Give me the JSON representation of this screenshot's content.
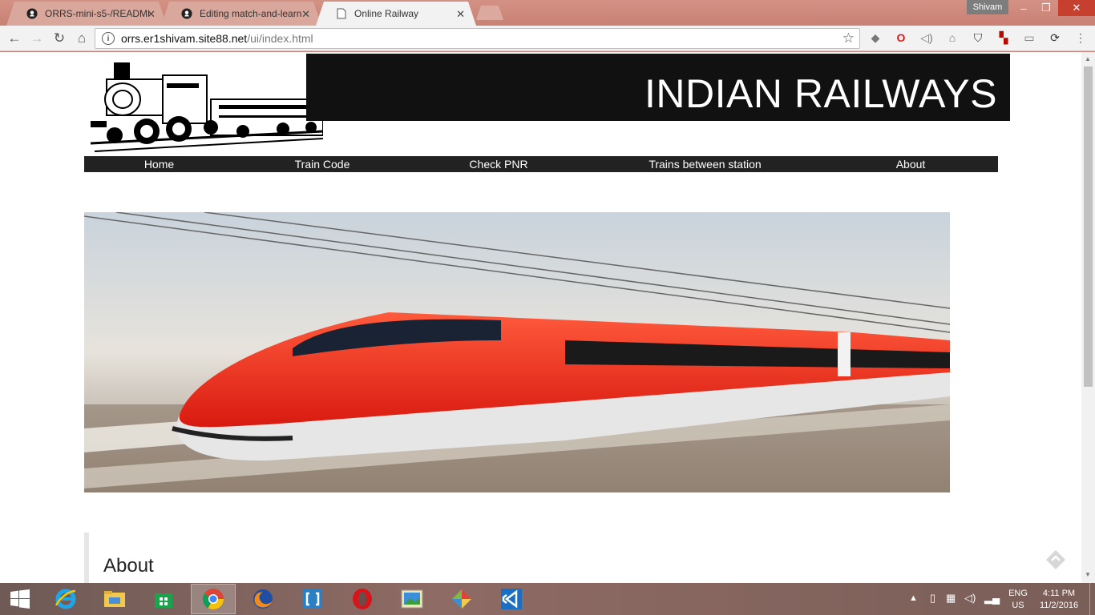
{
  "browser": {
    "tabs": [
      {
        "title": "ORRS-mini-s5-/README",
        "icon": "github-icon",
        "active": false
      },
      {
        "title": "Editing match-and-learn",
        "icon": "github-icon",
        "active": false
      },
      {
        "title": "Online Railway",
        "icon": "page-icon",
        "active": true
      }
    ],
    "profile_name": "Shivam",
    "url_host": "orrs.er1shivam.site88.net",
    "url_path": "/ui/index.html"
  },
  "page": {
    "brand_title": "INDIAN RAILWAYS",
    "menu": [
      {
        "label": "Home"
      },
      {
        "label": "Train Code"
      },
      {
        "label": "Check PNR"
      },
      {
        "label": "Trains between station"
      },
      {
        "label": "About"
      }
    ],
    "about_heading": "About",
    "colors": {
      "header_bg": "#111111",
      "menu_bg": "#222222",
      "train_red": "#e8251c"
    }
  },
  "taskbar": {
    "apps": [
      "start-icon",
      "internet-explorer-icon",
      "file-explorer-icon",
      "store-icon",
      "chrome-icon",
      "firefox-icon",
      "brackets-icon",
      "opera-icon",
      "photos-icon",
      "gems-icon",
      "visual-studio-code-icon"
    ],
    "language": "ENG",
    "region": "US",
    "time": "4:11 PM",
    "date": "11/2/2016"
  }
}
